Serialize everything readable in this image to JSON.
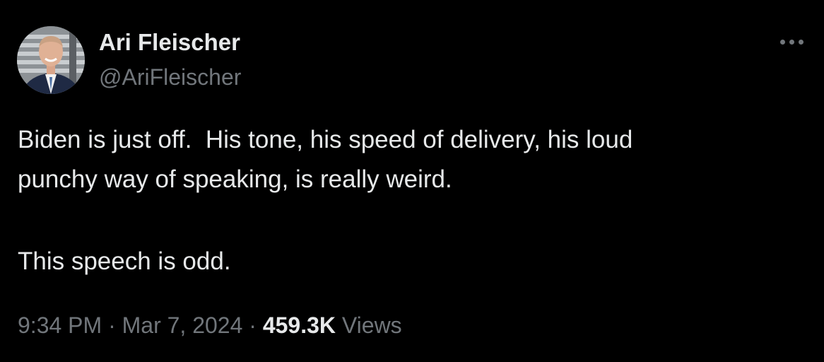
{
  "tweet": {
    "author_name": "Ari Fleischer",
    "author_handle": "@AriFleischer",
    "avatar_icon": "profile-photo",
    "more_icon": "more-horizontal-icon",
    "text_line_1": "Biden is just off.  His tone, his speed of delivery, his loud",
    "text_line_2": "punchy way of speaking, is really weird.",
    "text_line_3": "This speech is odd.",
    "time": "9:34 PM",
    "separator": " · ",
    "date": "Mar 7, 2024",
    "views_count": "459.3K",
    "views_label": "Views"
  },
  "colors": {
    "background": "#000000",
    "primary_text": "#e7e9ea",
    "secondary_text": "#71767b"
  }
}
